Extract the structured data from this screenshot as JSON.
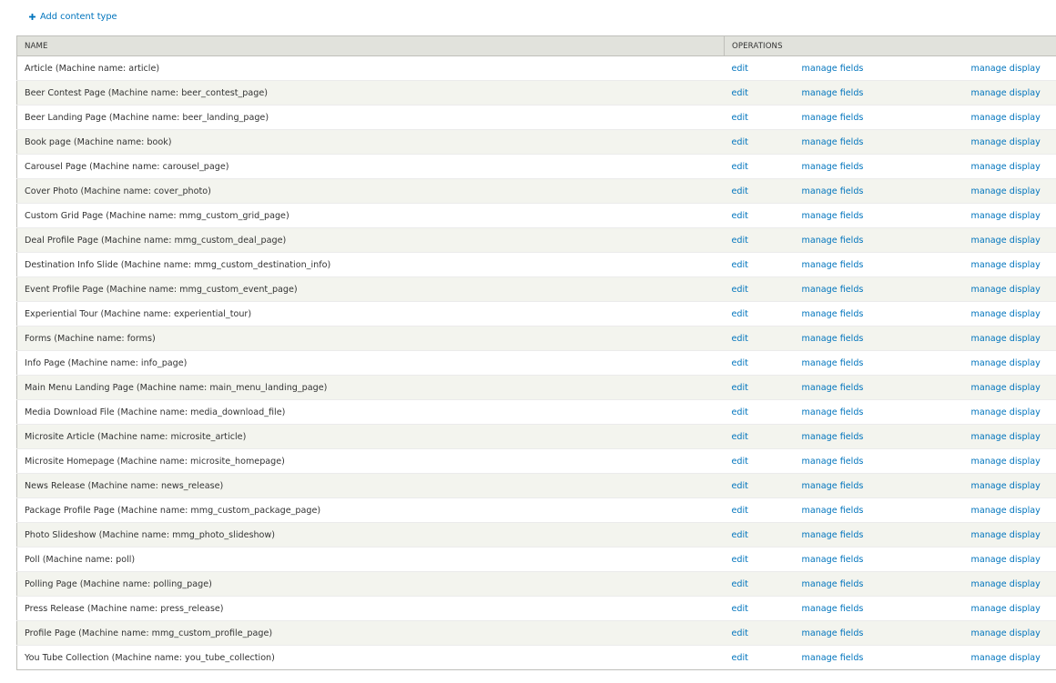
{
  "action_links": {
    "add_content_type": "Add content type",
    "icon": "plus-icon"
  },
  "colors": {
    "link": "#0074bd",
    "header_bg": "#e1e2dc",
    "row_alt_bg": "#f3f4ee",
    "border": "#bfbfba"
  },
  "table": {
    "headers": {
      "name": "NAME",
      "operations": "OPERATIONS"
    },
    "rows": [
      {
        "name": "Article (Machine name: article)",
        "edit": "edit",
        "manage_fields": "manage fields",
        "manage_display": "manage display"
      },
      {
        "name": "Beer Contest Page (Machine name: beer_contest_page)",
        "edit": "edit",
        "manage_fields": "manage fields",
        "manage_display": "manage display"
      },
      {
        "name": "Beer Landing Page (Machine name: beer_landing_page)",
        "edit": "edit",
        "manage_fields": "manage fields",
        "manage_display": "manage display"
      },
      {
        "name": "Book page (Machine name: book)",
        "edit": "edit",
        "manage_fields": "manage fields",
        "manage_display": "manage display"
      },
      {
        "name": "Carousel Page (Machine name: carousel_page)",
        "edit": "edit",
        "manage_fields": "manage fields",
        "manage_display": "manage display"
      },
      {
        "name": "Cover Photo (Machine name: cover_photo)",
        "edit": "edit",
        "manage_fields": "manage fields",
        "manage_display": "manage display"
      },
      {
        "name": "Custom Grid Page (Machine name: mmg_custom_grid_page)",
        "edit": "edit",
        "manage_fields": "manage fields",
        "manage_display": "manage display"
      },
      {
        "name": "Deal Profile Page (Machine name: mmg_custom_deal_page)",
        "edit": "edit",
        "manage_fields": "manage fields",
        "manage_display": "manage display"
      },
      {
        "name": "Destination Info Slide (Machine name: mmg_custom_destination_info)",
        "edit": "edit",
        "manage_fields": "manage fields",
        "manage_display": "manage display"
      },
      {
        "name": "Event Profile Page (Machine name: mmg_custom_event_page)",
        "edit": "edit",
        "manage_fields": "manage fields",
        "manage_display": "manage display"
      },
      {
        "name": "Experiential Tour (Machine name: experiential_tour)",
        "edit": "edit",
        "manage_fields": "manage fields",
        "manage_display": "manage display"
      },
      {
        "name": "Forms (Machine name: forms)",
        "edit": "edit",
        "manage_fields": "manage fields",
        "manage_display": "manage display"
      },
      {
        "name": "Info Page (Machine name: info_page)",
        "edit": "edit",
        "manage_fields": "manage fields",
        "manage_display": "manage display"
      },
      {
        "name": "Main Menu Landing Page (Machine name: main_menu_landing_page)",
        "edit": "edit",
        "manage_fields": "manage fields",
        "manage_display": "manage display"
      },
      {
        "name": "Media Download File (Machine name: media_download_file)",
        "edit": "edit",
        "manage_fields": "manage fields",
        "manage_display": "manage display"
      },
      {
        "name": "Microsite Article (Machine name: microsite_article)",
        "edit": "edit",
        "manage_fields": "manage fields",
        "manage_display": "manage display"
      },
      {
        "name": "Microsite Homepage (Machine name: microsite_homepage)",
        "edit": "edit",
        "manage_fields": "manage fields",
        "manage_display": "manage display"
      },
      {
        "name": "News Release (Machine name: news_release)",
        "edit": "edit",
        "manage_fields": "manage fields",
        "manage_display": "manage display"
      },
      {
        "name": "Package Profile Page (Machine name: mmg_custom_package_page)",
        "edit": "edit",
        "manage_fields": "manage fields",
        "manage_display": "manage display"
      },
      {
        "name": "Photo Slideshow (Machine name: mmg_photo_slideshow)",
        "edit": "edit",
        "manage_fields": "manage fields",
        "manage_display": "manage display"
      },
      {
        "name": "Poll (Machine name: poll)",
        "edit": "edit",
        "manage_fields": "manage fields",
        "manage_display": "manage display"
      },
      {
        "name": "Polling Page (Machine name: polling_page)",
        "edit": "edit",
        "manage_fields": "manage fields",
        "manage_display": "manage display"
      },
      {
        "name": "Press Release (Machine name: press_release)",
        "edit": "edit",
        "manage_fields": "manage fields",
        "manage_display": "manage display"
      },
      {
        "name": "Profile Page (Machine name: mmg_custom_profile_page)",
        "edit": "edit",
        "manage_fields": "manage fields",
        "manage_display": "manage display"
      },
      {
        "name": "You Tube Collection (Machine name: you_tube_collection)",
        "edit": "edit",
        "manage_fields": "manage fields",
        "manage_display": "manage display"
      }
    ]
  }
}
